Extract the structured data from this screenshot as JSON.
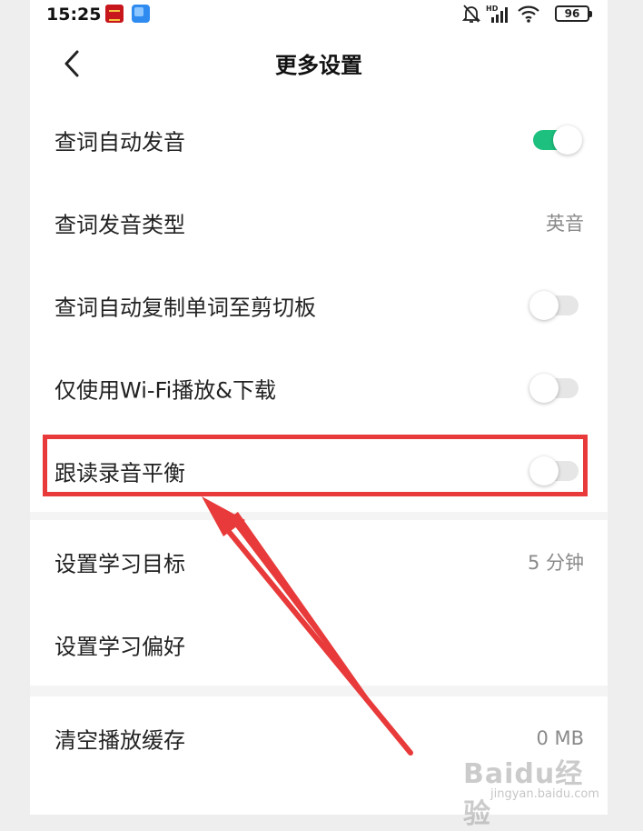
{
  "status_bar": {
    "time": "15:25",
    "battery": "96",
    "network": "HD"
  },
  "header": {
    "title": "更多设置"
  },
  "settings": {
    "group1": [
      {
        "label": "查词自动发音",
        "control": "toggle",
        "on": true
      },
      {
        "label": "查词发音类型",
        "control": "value",
        "value": "英音"
      },
      {
        "label": "查词自动复制单词至剪切板",
        "control": "toggle",
        "on": false
      },
      {
        "label": "仅使用Wi-Fi播放&下载",
        "control": "toggle",
        "on": false
      },
      {
        "label": "跟读录音平衡",
        "control": "toggle",
        "on": false
      }
    ],
    "group2": [
      {
        "label": "设置学习目标",
        "control": "value",
        "value": "5 分钟"
      },
      {
        "label": "设置学习偏好",
        "control": "none"
      }
    ],
    "group3": [
      {
        "label": "清空播放缓存",
        "control": "value",
        "value": "0 MB"
      }
    ]
  },
  "watermark": {
    "text": "Baidu经验",
    "sub": "jingyan.baidu.com"
  },
  "colors": {
    "toggle_on": "#1dc07f",
    "toggle_off": "#e6e6e6",
    "highlight": "#e83a3a"
  }
}
